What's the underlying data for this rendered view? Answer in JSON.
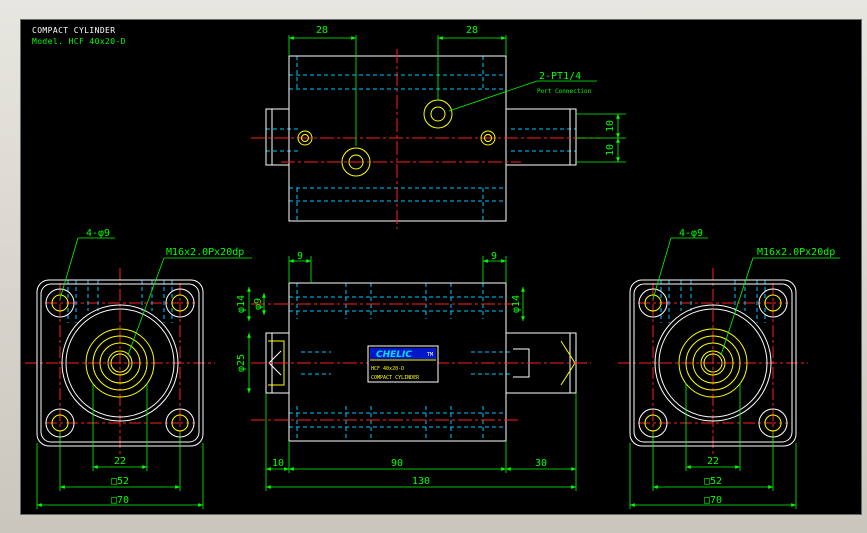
{
  "title_block": {
    "line1": "COMPACT CYLINDER",
    "line2": "Model. HCF 40x20-D"
  },
  "top_view": {
    "dim_left": "28",
    "dim_right": "28",
    "port_label": "2-PT1/4",
    "port_note": "Port Connection",
    "dim_v1": "10",
    "dim_v2": "10"
  },
  "left_view": {
    "holes": "4-φ9",
    "thread": "M16x2.0Px20dp",
    "dim_inner": "22",
    "dim_mid": "□52",
    "dim_outer": "□70"
  },
  "right_view": {
    "holes": "4-φ9",
    "thread": "M16x2.0Px20dp",
    "dim_inner": "22",
    "dim_mid": "□52",
    "dim_outer": "□70"
  },
  "front_view": {
    "dim_top_left": "9",
    "dim_top_right": "9",
    "dia_left": "φ14",
    "dia_inner": "φ9",
    "dia_right": "φ14",
    "dia_rod": "φ25",
    "dim_a": "10",
    "dim_b": "90",
    "dim_c": "30",
    "dim_total": "130"
  },
  "nameplate": {
    "brand": "CHELIC",
    "tag": "TM",
    "model": "HCF 40x20-D",
    "name": "COMPACT CYLINDER"
  },
  "colors": {
    "outline": "#ffffff",
    "hidden": "#00c8ff",
    "center": "#ff2020",
    "dimension": "#00ff00",
    "feature": "#ffff00",
    "background": "#000000"
  }
}
